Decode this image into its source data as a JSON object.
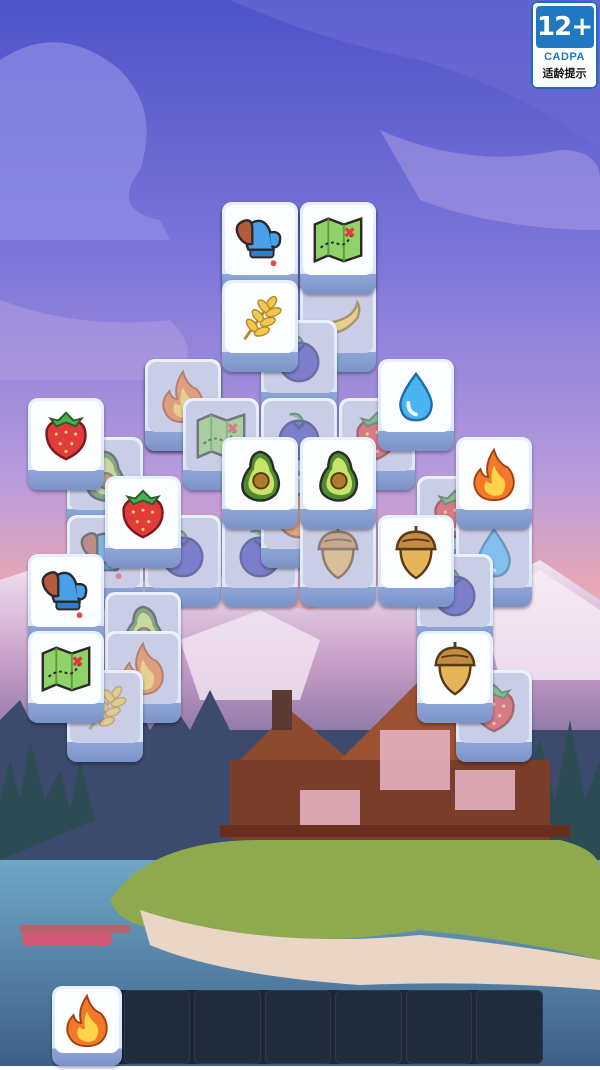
{
  "age_rating": {
    "label": "12+",
    "org": "CADPA",
    "hint": "适龄提示"
  },
  "board": {
    "tiles": [
      {
        "icon": "mitten-icon",
        "dim": true
      },
      {
        "icon": "map-icon",
        "dim": true
      },
      {
        "icon": "flame-icon",
        "dim": true
      },
      {
        "icon": "banana-icon",
        "dim": true
      },
      {
        "icon": "blueberry-icon",
        "dim": true
      },
      {
        "icon": "flame-icon",
        "dim": true
      },
      {
        "icon": "map-icon",
        "dim": true
      },
      {
        "icon": "blueberry-icon",
        "dim": true
      },
      {
        "icon": "strawberry-icon",
        "dim": true
      },
      {
        "icon": "avocado-icon",
        "dim": true
      },
      {
        "icon": "blueberry-icon",
        "dim": true
      },
      {
        "icon": "blueberry-icon",
        "dim": true
      },
      {
        "icon": "orange-icon",
        "dim": true
      },
      {
        "icon": "acorn-icon",
        "dim": true
      },
      {
        "icon": "strawberry-icon",
        "dim": true
      },
      {
        "icon": "water-drop-icon",
        "dim": true
      },
      {
        "icon": "blueberry-icon",
        "dim": true
      },
      {
        "icon": "mitten-icon",
        "dim": true
      },
      {
        "icon": "avocado-icon",
        "dim": true
      },
      {
        "icon": "flame-icon",
        "dim": true
      },
      {
        "icon": "wheat-icon",
        "dim": true
      },
      {
        "icon": "strawberry-icon",
        "dim": true
      },
      {
        "icon": "mitten-icon",
        "dim": false
      },
      {
        "icon": "map-icon",
        "dim": false
      },
      {
        "icon": "wheat-icon",
        "dim": false
      },
      {
        "icon": "water-drop-icon",
        "dim": false
      },
      {
        "icon": "strawberry-icon",
        "dim": false
      },
      {
        "icon": "avocado-icon",
        "dim": false
      },
      {
        "icon": "avocado-icon",
        "dim": false
      },
      {
        "icon": "flame-icon",
        "dim": false
      },
      {
        "icon": "strawberry-icon",
        "dim": false
      },
      {
        "icon": "acorn-icon",
        "dim": false
      },
      {
        "icon": "mitten-icon",
        "dim": false
      },
      {
        "icon": "map-icon",
        "dim": false
      },
      {
        "icon": "acorn-icon",
        "dim": false
      }
    ]
  },
  "tray": {
    "slots": [
      "flame-icon",
      null,
      null,
      null,
      null,
      null,
      null
    ]
  },
  "colors": {
    "sky_top": "#5a54c8",
    "sky_mid": "#9a86d8",
    "sunset": "#e7a3b6",
    "tile_face": "#fbfdff",
    "tile_side": "#8fa6d8",
    "tray": "#1d2636",
    "badge_blue": "#1f78c1"
  }
}
